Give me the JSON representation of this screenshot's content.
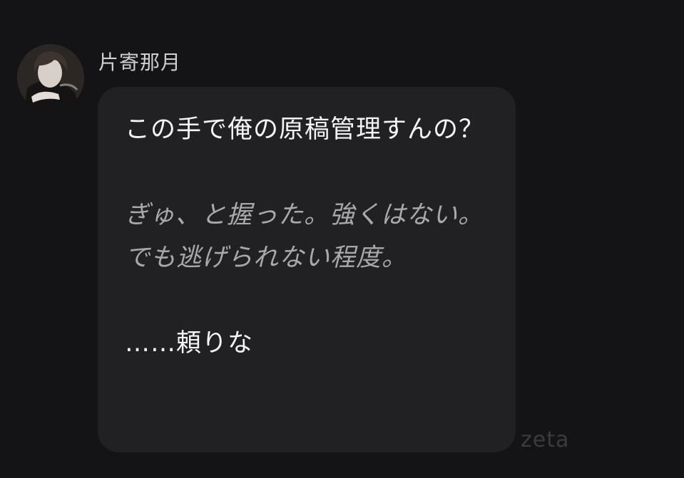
{
  "message": {
    "sender_name": "片寄那月",
    "avatar_icon": "character-portrait-avatar",
    "paragraphs": [
      {
        "style": "dialogue",
        "text": "この手で俺の原稿管理すんの？"
      },
      {
        "style": "action",
        "text": "ぎゅ、と握った。強くはない。でも逃げられない程度。"
      },
      {
        "style": "dialogue",
        "text": "……頼りな"
      }
    ]
  },
  "watermark": "zeta",
  "colors": {
    "background": "#141416",
    "bubble": "#212123",
    "dialogue_text": "#f4f4f5",
    "action_text": "#a9a9ad"
  }
}
